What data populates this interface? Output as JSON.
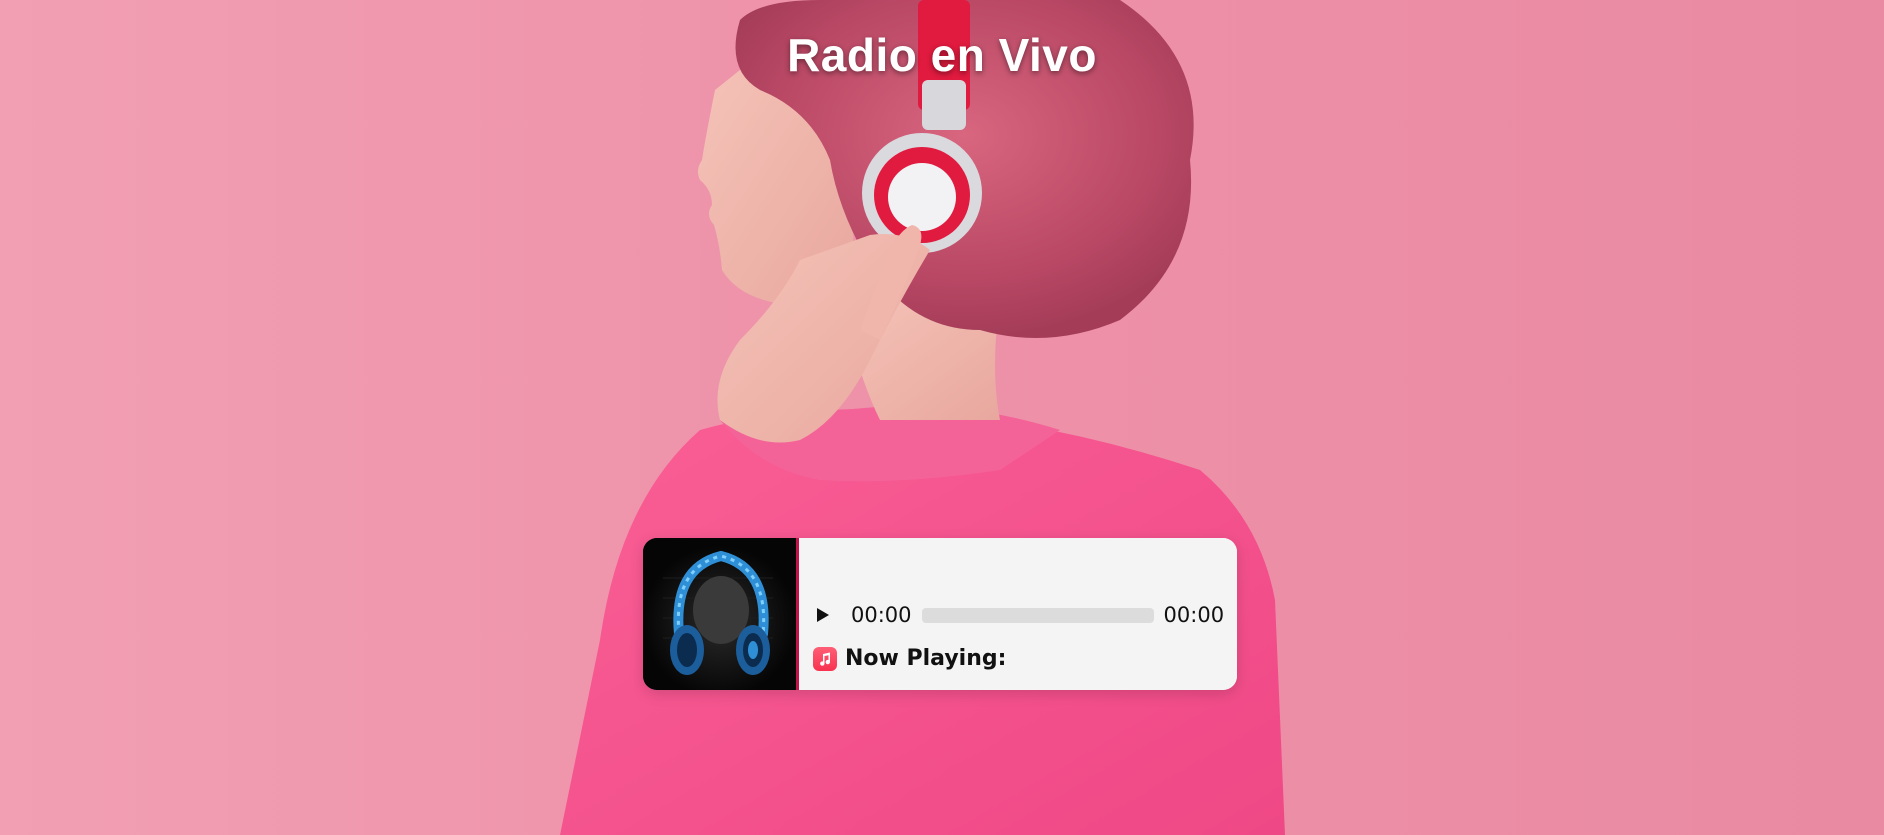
{
  "page": {
    "title": "Radio en Vivo",
    "background_color": "#ee93aa"
  },
  "player": {
    "play_icon": "play-icon",
    "current_time": "00:00",
    "duration": "00:00",
    "progress": 0,
    "now_playing_icon": "music-note-icon",
    "now_playing_label": "Now Playing:",
    "now_playing_track": "",
    "accent_color": "#c2144a",
    "album_art": "headphones-album-art"
  }
}
